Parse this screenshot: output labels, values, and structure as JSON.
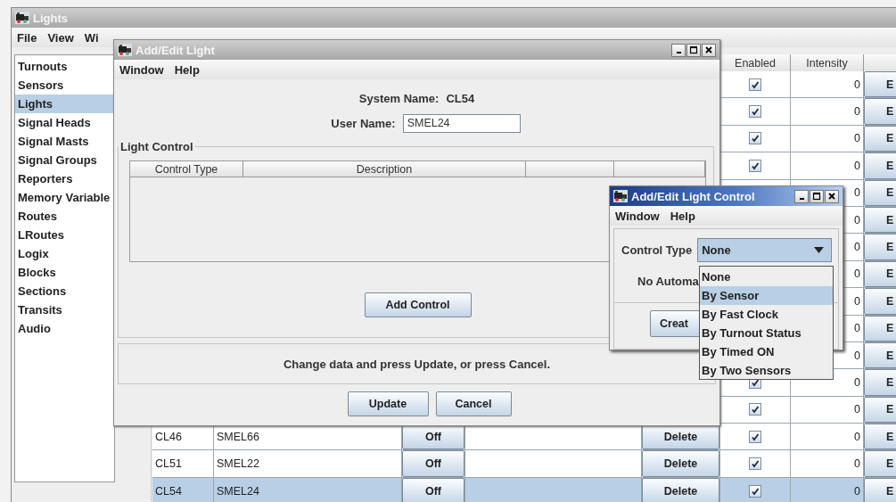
{
  "main_window": {
    "title": "Lights",
    "active": false,
    "menu": [
      "File",
      "View",
      "Wi"
    ],
    "sidebar": [
      {
        "label": "Turnouts",
        "selected": false
      },
      {
        "label": "Sensors",
        "selected": false
      },
      {
        "label": "Lights",
        "selected": true
      },
      {
        "label": "Signal Heads",
        "selected": false
      },
      {
        "label": "Signal Masts",
        "selected": false
      },
      {
        "label": "Signal Groups",
        "selected": false
      },
      {
        "label": "Reporters",
        "selected": false
      },
      {
        "label": "Memory Variable",
        "selected": false
      },
      {
        "label": "Routes",
        "selected": false
      },
      {
        "label": "LRoutes",
        "selected": false
      },
      {
        "label": "Logix",
        "selected": false
      },
      {
        "label": "Blocks",
        "selected": false
      },
      {
        "label": "Sections",
        "selected": false
      },
      {
        "label": "Transits",
        "selected": false
      },
      {
        "label": "Audio",
        "selected": false
      }
    ]
  },
  "lights_table": {
    "columns": [
      "Enabled",
      "Intensity"
    ],
    "rows": [
      {
        "enabled": true,
        "intensity": "0",
        "edit": "E",
        "selected": false
      },
      {
        "enabled": true,
        "intensity": "0",
        "edit": "E",
        "selected": false
      },
      {
        "enabled": true,
        "intensity": "0",
        "edit": "E",
        "selected": false
      },
      {
        "enabled": true,
        "intensity": "0",
        "edit": "E",
        "selected": false
      },
      {
        "intensity": "0",
        "edit": "E",
        "selected": false
      },
      {
        "intensity": "0",
        "edit": "E",
        "selected": false
      },
      {
        "intensity": "0",
        "edit": "E",
        "selected": false
      },
      {
        "intensity": "0",
        "edit": "E",
        "selected": false
      },
      {
        "intensity": "0",
        "edit": "E",
        "selected": false
      },
      {
        "intensity": "0",
        "edit": "E",
        "selected": false
      },
      {
        "intensity": "0",
        "edit": "E",
        "selected": false
      },
      {
        "enabled": true,
        "intensity": "0",
        "edit": "E",
        "selected": false
      },
      {
        "enabled": true,
        "intensity": "0",
        "edit": "E",
        "selected": false
      },
      {
        "system_name": "CL46",
        "user_name": "SMEL66",
        "state": "Off",
        "delete": "Delete",
        "enabled": true,
        "intensity": "0",
        "edit": "E",
        "selected": false
      },
      {
        "system_name": "CL51",
        "user_name": "SMEL22",
        "state": "Off",
        "delete": "Delete",
        "enabled": true,
        "intensity": "0",
        "edit": "E",
        "selected": false
      },
      {
        "system_name": "CL54",
        "user_name": "SMEL24",
        "state": "Off",
        "delete": "Delete",
        "enabled": true,
        "intensity": "0",
        "edit": "E",
        "selected": true
      }
    ]
  },
  "edit_dialog": {
    "title": "Add/Edit Light",
    "active": false,
    "menu": [
      "Window",
      "Help"
    ],
    "system_name_label": "System Name:",
    "system_name": "CL54",
    "user_name_label": "User Name:",
    "user_name": "SMEL24",
    "group_title": "Light Control",
    "control_columns": [
      "Control Type",
      "Description"
    ],
    "add_button": "Add Control",
    "message": "Change data and press Update, or press Cancel.",
    "buttons": [
      "Update",
      "Cancel"
    ]
  },
  "control_dialog": {
    "title": "Add/Edit Light Control",
    "active": true,
    "menu": [
      "Window",
      "Help"
    ],
    "control_type_label": "Control Type",
    "control_type": "None",
    "status_text": "No Automa",
    "create_button": "Creat",
    "options": [
      {
        "label": "None",
        "selected": false
      },
      {
        "label": "By Sensor",
        "selected": true
      },
      {
        "label": "By Fast Clock",
        "selected": false
      },
      {
        "label": "By Turnout Status",
        "selected": false
      },
      {
        "label": "By Timed ON",
        "selected": false
      },
      {
        "label": "By Two Sensors",
        "selected": false
      }
    ]
  }
}
